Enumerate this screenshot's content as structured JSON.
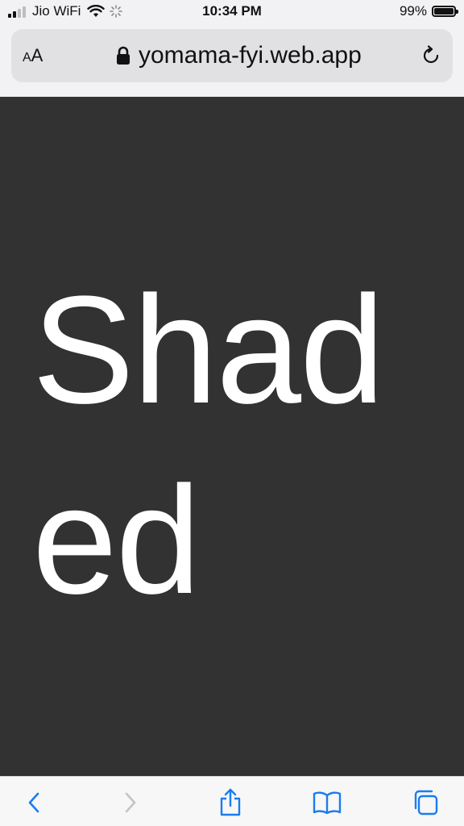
{
  "status_bar": {
    "carrier": "Jio WiFi",
    "time": "10:34 PM",
    "battery_percent": "99%",
    "battery_level": 0.99,
    "signal_bars": 2,
    "signal_bars_total": 4
  },
  "browser": {
    "text_size_label_small": "A",
    "text_size_label_big": "A",
    "url": "yomama-fyi.web.app",
    "accent_color": "#1a7cf0"
  },
  "page": {
    "headline": "Shaded",
    "background_color": "#323232",
    "text_color": "#ffffff"
  },
  "toolbar": {
    "buttons": [
      "back",
      "forward",
      "share",
      "bookmarks",
      "tabs"
    ],
    "forward_enabled": false
  }
}
